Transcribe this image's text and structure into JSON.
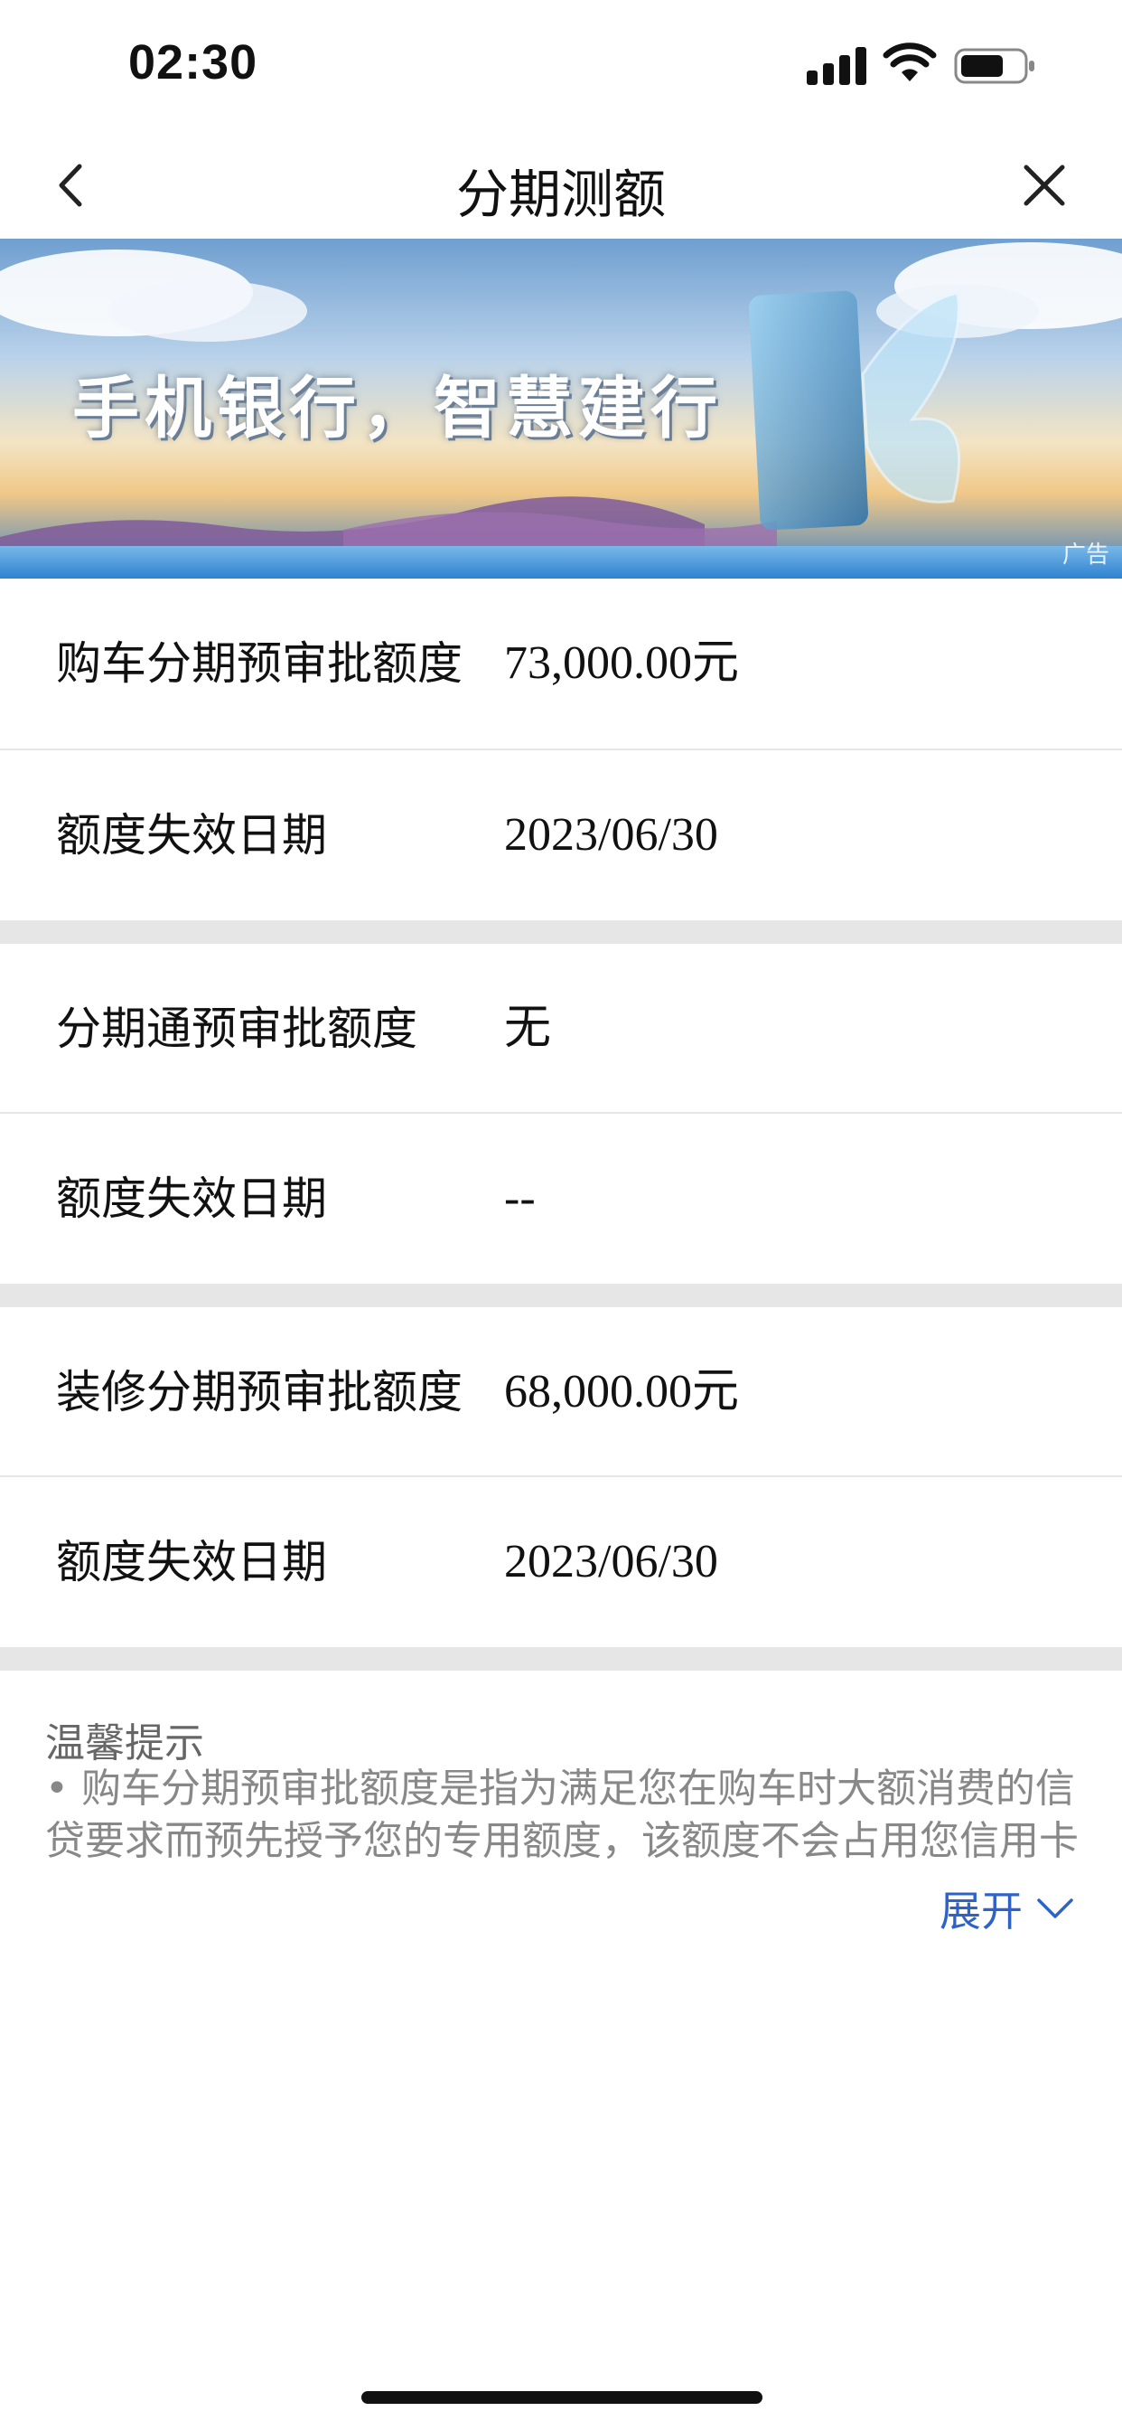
{
  "status_bar": {
    "time": "02:30"
  },
  "nav": {
    "title": "分期测额"
  },
  "banner": {
    "slogan": "手机银行，智慧建行",
    "ad_tag": "广告"
  },
  "sections": [
    {
      "rows": [
        {
          "label": "购车分期预审批额度",
          "value": "73,000.00元"
        },
        {
          "label": "额度失效日期",
          "value": "2023/06/30"
        }
      ]
    },
    {
      "rows": [
        {
          "label": "分期通预审批额度",
          "value": "无"
        },
        {
          "label": "额度失效日期",
          "value": "--"
        }
      ]
    },
    {
      "rows": [
        {
          "label": "装修分期预审批额度",
          "value": "68,000.00元"
        },
        {
          "label": "额度失效日期",
          "value": "2023/06/30"
        }
      ]
    }
  ],
  "tip": {
    "title": "温馨提示",
    "text": "• 购车分期预审批额度是指为满足您在购车时大额消费的信贷要求而预先授予您的专用额度，该额度不会占用您信用卡",
    "expand_label": "展开"
  },
  "colors": {
    "accent": "#2e62c9",
    "separator": "#e6e6e6"
  }
}
